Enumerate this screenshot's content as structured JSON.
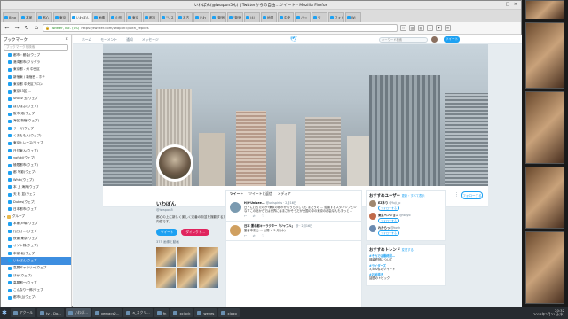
{
  "window": {
    "title": "いわぽん(@iwapon5ん) | Twitterからの自由…ツイート - Mozilla Firefox"
  },
  "tabs": [
    {
      "label": "Bing"
    },
    {
      "label": "本家"
    },
    {
      "label": "都心"
    },
    {
      "label": "東京"
    },
    {
      "label": "いわぽん"
    },
    {
      "label": "画像"
    },
    {
      "label": "山形"
    },
    {
      "label": "東京"
    },
    {
      "label": "都市"
    },
    {
      "label": "\"リス"
    },
    {
      "label": "名古"
    },
    {
      "label": "いわ"
    },
    {
      "label": "\"新宿"
    },
    {
      "label": "\"新宿"
    },
    {
      "label": "(4)"
    },
    {
      "label": "地図"
    },
    {
      "label": "中央"
    },
    {
      "label": "ハッ"
    },
    {
      "label": "ウ"
    },
    {
      "label": "フォト"
    },
    {
      "label": "Wi"
    }
  ],
  "navbar": {
    "url_owner": "Twitter, Inc. (US)",
    "url": "https://twitter.com/iwapon5/with_replies",
    "back": "←",
    "forward": "→",
    "reload": "↻",
    "home": "⌂"
  },
  "sidebar": {
    "title": "ブックマーク",
    "close": "×",
    "search_placeholder": "ブックマークを検索",
    "items": [
      {
        "label": "都市・都会(ウェブ",
        "type": "bm"
      },
      {
        "label": "港湾都市(フリグラ",
        "type": "bm"
      },
      {
        "label": "東京都 - 州 中央区",
        "type": "bm"
      },
      {
        "label": "新宿東 / 新宿西 - ホテ",
        "type": "bm"
      },
      {
        "label": "東京都 中央区フロン",
        "type": "bm"
      },
      {
        "label": "東京23区 ...",
        "type": "bm"
      },
      {
        "label": "Shokz 五(ウェブ",
        "type": "bm"
      },
      {
        "label": "ばびぱぷ(ウェブ)",
        "type": "bm"
      },
      {
        "label": "阪市 港(ウェブ",
        "type": "bm"
      },
      {
        "label": "海区 新宿(ウェブ)",
        "type": "bm"
      },
      {
        "label": "サーガ(ウェブ",
        "type": "bm"
      },
      {
        "label": "くまももん(ウェブ)",
        "type": "bm"
      },
      {
        "label": "東京トレース(ウェブ",
        "type": "bm"
      },
      {
        "label": "日付東入(ウェブ)",
        "type": "bm"
      },
      {
        "label": "yofuki(ウェブ)",
        "type": "bm"
      },
      {
        "label": "極限都市(ウェブ)",
        "type": "bm"
      },
      {
        "label": "都 写影(ウェブ)",
        "type": "bm"
      },
      {
        "label": "Whtc(ウェブ)",
        "type": "bm"
      },
      {
        "label": "本 上 海岸(ウェブ",
        "type": "bm"
      },
      {
        "label": "天 杉 並(ウェブ",
        "type": "bm"
      },
      {
        "label": "Dukes(ウェブ)",
        "type": "bm"
      },
      {
        "label": "日本都市(ウェブ",
        "type": "bm"
      },
      {
        "label": "グループ",
        "type": "folder"
      },
      {
        "label": "本家 戸塚(ウェブ",
        "type": "bm"
      },
      {
        "label": "(公式) ...(ウェブ",
        "type": "bm"
      },
      {
        "label": "夜景 東京(ウェブ",
        "type": "bm"
      },
      {
        "label": "オソン株(ウェブ)",
        "type": "bm"
      },
      {
        "label": "本家 坂(ウェブ",
        "type": "bm"
      },
      {
        "label": "いわぽん(ウェブ",
        "type": "bm",
        "selected": true
      },
      {
        "label": "高層ギャラリー(ウェブ",
        "type": "bm"
      },
      {
        "label": "ほか(ウェブ)",
        "type": "bm"
      },
      {
        "label": "高層都一(ウェブ",
        "type": "bm"
      },
      {
        "label": "こんなり一郎(ウェブ",
        "type": "bm"
      },
      {
        "label": "都市 山(ウェブ)",
        "type": "bm"
      }
    ]
  },
  "twitter": {
    "nav": {
      "home": "ホーム",
      "moments": "モーメント",
      "notifications": "通知",
      "messages": "メッセージ",
      "search": "キーワード検索",
      "tweet": "ツイート"
    },
    "stats": [
      {
        "label": "ツイート",
        "value": "14,968"
      },
      {
        "label": "フォロー",
        "value": "1,442"
      },
      {
        "label": "フォロワー",
        "value": "1,304"
      },
      {
        "label": "いいね",
        "value": "18,390"
      }
    ],
    "follow": "フォローする",
    "more": "⋮",
    "profile": {
      "name": "いわぽん",
      "handle": "@iwapon5",
      "bio": "都心の上に新しく楽しく定番の街並を撮影する方向性です。",
      "btn1": "ツイート",
      "btn2": "ダイレクト…",
      "media": "375 画像と動画"
    },
    "timeline_tabs": [
      "ツイート",
      "ツイートと返信",
      "メディア"
    ],
    "tweets": [
      {
        "name": "H/Y-Unisee...",
        "handle": "@unispirits · 2月16日",
        "text": "日下に打ちたのか?東京の都市からうちのしても またうの … 結論するスタンシブと少なすこの北からでは世界にはまさかそうだが全国の中の東京の都会なんもずっと…",
        "acts": "↩ ⇄ ♡"
      },
      {
        "name": "日本 運北都キャラクター「ジャブル」",
        "handle": "@ · 2月16日",
        "text": "聖者本来比 … 公開 × 5 月 (木)",
        "acts": "↩ ⇄ ♡"
      }
    ],
    "who_title": "おすすめユーザー",
    "who_refresh": "更新・すべて表示",
    "who": [
      {
        "name": "EZ多り",
        "handle": "@fuji_jp",
        "follow": "フォローする"
      },
      {
        "name": "東京ペンション",
        "handle": "@tokyo",
        "follow": "フォローする"
      },
      {
        "name": "れからっ",
        "handle": "@kosh",
        "follow": "フォローする"
      }
    ],
    "trends_title": "おすすめトレンド",
    "trends_change": "変更する",
    "trends": [
      {
        "tag": "#それでは最終回…",
        "desc": "部最終回について"
      },
      {
        "tag": "#ライダーズ",
        "desc": "3,500件のツイート"
      },
      {
        "tag": "#お絵描き",
        "desc": "話題のトピック"
      }
    ]
  },
  "taskbar": {
    "items": [
      "アクール",
      "tv – Do...",
      "いわぽ...",
      "xemacs2...",
      "a_スクリ...",
      "fn",
      "xclock",
      "weyes",
      "xlogo"
    ],
    "clock_time": "20:32",
    "clock_date": "2018年2月21日(水)"
  }
}
